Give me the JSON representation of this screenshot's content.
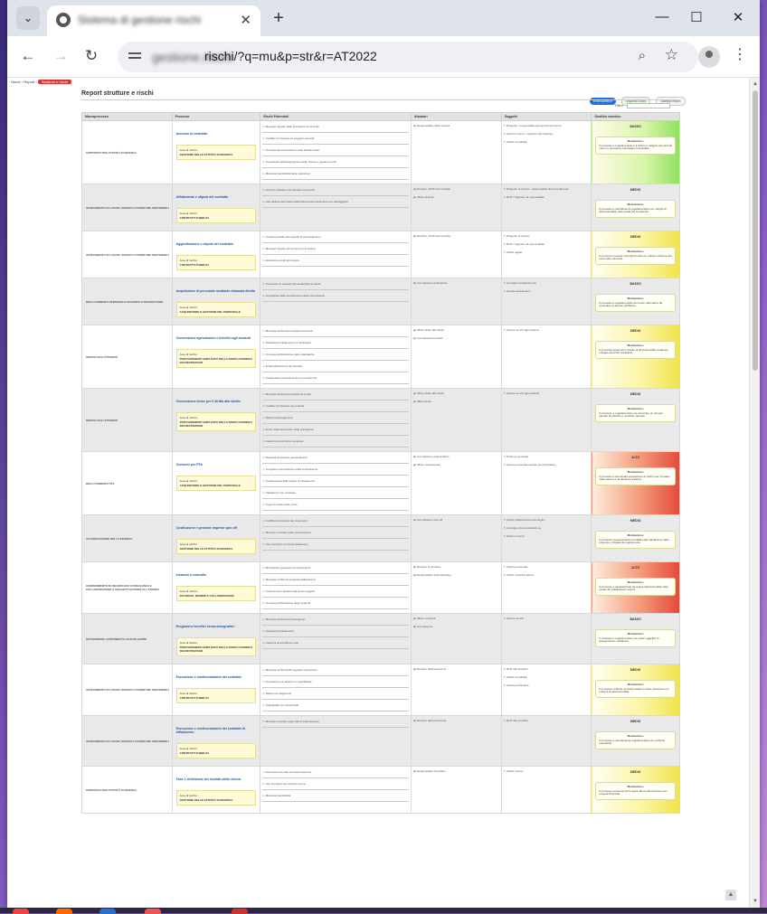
{
  "browser": {
    "tab_title": "Sistema di gestione rischi",
    "host_blurred": "gestione.rischi",
    "url": "rischi/?q=mu&p=str&r=AT2022"
  },
  "page": {
    "breadcrumb": [
      "Home",
      "Report",
      "Strutture e rischi"
    ],
    "title": "Report strutture e rischi",
    "actions": [
      "ESEGUIBILE",
      "Esporta Excel",
      "Stampa report"
    ],
    "filter_label": "Filtro",
    "filter_value": ""
  },
  "table": {
    "headers": [
      "Macroprocesso",
      "Processo",
      "Rischi Potenziali",
      "Attuatori",
      "Soggetti",
      "Giudizio sintetico"
    ],
    "rows": [
      {
        "macro": "SUPPORTO PER ATTIVITÀ DI RICERCA",
        "process": "Accesso al contratto",
        "area": "GESTIONE DELLE ATTIVITÀ DI RICERCA",
        "risks": [
          "Mancato rispetto delle procedure di controllo",
          "Conflitto di interessi tra soggetti coinvolti",
          "Omessa documentazione delle attività svolte",
          "Irregolarità nell'assegnazione delle risorse e gestione fondi",
          "Mancata tracciabilità delle operazioni"
        ],
        "actors": [
          "Responsabile ufficio ricerca"
        ],
        "subjects": [
          "Dirigente / responsabile del servizio di ricerca",
          "Settore ricerca - supporto alle strutture",
          "Ufficio contabilità"
        ],
        "level": "BASSO",
        "level_key": "g-basso",
        "motivation": "Il processo è regolamentato e il rischio è mitigato da controlli interni e procedure strutturate consolidate."
      },
      {
        "macro": "AFFIDAMENTO DI LAVORI, SERVIZI E FORNITURE SOSTENIBILI",
        "process": "Affidamento e stipula del contratto",
        "area": "CONTRATTI PUBBLICI",
        "risks": [
          "Accordo collusivo tra operatori economici",
          "Uso distorto del criterio dell'offerta economicamente più vantaggiosa"
        ],
        "actors": [
          "Direttore / RUP del contratto",
          "Ufficio acquisti"
        ],
        "subjects": [
          "Dirigente di settore - responsabile del procedimento",
          "RUP / Supporto al responsabile"
        ],
        "level": "MEDIO",
        "level_key": "g-medio",
        "motivation": "Il processo è parzialmente regolamentato con margini di discrezionalità nella scelta del contraente."
      },
      {
        "macro": "AFFIDAMENTO DI LAVORI, SERVIZI E FORNITURE SOSTENIBILI",
        "process": "Aggiudicazione e stipula del contratto",
        "area": "CONTRATTI PUBBLICI",
        "risks": [
          "Verifica parziale dei requisiti di partecipazione",
          "Mancato rispetto dei termini per la stipula",
          "Alterazione degli atti di gara"
        ],
        "actors": [
          "Direttore / RUP del contratto"
        ],
        "subjects": [
          "Dirigente di settore",
          "RUP / Supporto al responsabile",
          "Ufficio legale"
        ],
        "level": "MEDIO",
        "level_key": "g-medio",
        "motivation": "Il processo prevede controlli formali con ridotta rotazione del personale coinvolto."
      },
      {
        "macro": "RECLUTAMENTO PERSONALE DOCENTE E RICERCATORE",
        "process": "Acquisizione di personale mediante chiamata diretta",
        "area": "ACQUISIZIONE E GESTIONE DEL PERSONALE",
        "risks": [
          "Previsione di requisiti personalizzati nei bandi",
          "Irregolarità nella composizione delle commissioni"
        ],
        "actors": [
          "Commissione giudicatrice"
        ],
        "subjects": [
          "Consiglio di dipartimento",
          "Senato accademico"
        ],
        "level": "BASSO",
        "level_key": "g-basso",
        "motivation": "Il processo è regolamentato da norme nazionali e da procedure di ateneo pubbliche."
      },
      {
        "macro": "SERVIZI AGLI STUDENTI",
        "process": "Concessione agevolazioni e benefici agli studenti",
        "area": "PROVVEDIMENTI AMPLIATIVI DELLA SFERA GIURIDICA DEI DESTINATARI",
        "risks": [
          "Mancata verifica dei requisiti economici",
          "Disparità di trattamento tra richiedenti",
          "Omessa pubblicazione delle graduatorie",
          "Errata attribuzione dei benefici",
          "Inadeguata motivazione dei provvedimenti"
        ],
        "actors": [
          "Ufficio diritto allo studio",
          "Commissione benefici"
        ],
        "subjects": [
          "Settore servizi agli studenti"
        ],
        "level": "MEDIO",
        "level_key": "g-medio",
        "motivation": "Il processo presenta un livello di discrezionalità moderato, mitigato da criteri predefiniti."
      },
      {
        "macro": "SERVIZI AGLI STUDENTI",
        "process": "Concessione borse per il diritto allo studio",
        "area": "PROVVEDIMENTI AMPLIATIVI DELLA SFERA GIURIDICA DEI DESTINATARI",
        "risks": [
          "Mancata verifica dei requisiti di merito",
          "Conflitto di interessi nei controlli",
          "Ritardi nell'erogazione",
          "Errori nella formazione delle graduatorie",
          "Carenza di controlli a campione"
        ],
        "actors": [
          "Ufficio diritto allo studio",
          "Ufficio borse"
        ],
        "subjects": [
          "Settore servizi agli studenti"
        ],
        "level": "MEDIO",
        "level_key": "g-medio",
        "motivation": "Il processo è regolamentato ma coinvolge un numero elevato di pratiche e verifiche manuali."
      },
      {
        "macro": "RECLUTAMENTO PTA",
        "process": "Concorsi per PTA",
        "area": "ACQUISIZIONE E GESTIONE DEL PERSONALE",
        "risks": [
          "Requisiti di accesso personalizzati",
          "Irregolare composizione della commissione",
          "Inosservanza delle regole di trasparenza",
          "Valutazioni non motivate",
          "Fuga di notizie sulle prove"
        ],
        "actors": [
          "Commissione esaminatrice",
          "Ufficio reclutamento"
        ],
        "subjects": [
          "Direttore generale",
          "Settore personale tecnico amministrativo"
        ],
        "level": "ALTO",
        "level_key": "g-alto",
        "motivation": "Il processo è ad elevata esposizione al rischio per l'impatto sulle carriere e la rilevanza esterna."
      },
      {
        "macro": "VALORIZZAZIONE DELLA RICERCA",
        "process": "Costituzione e gestione imprese spin off",
        "area": "GESTIONE DELLE ATTIVITÀ DI RICERCA",
        "risks": [
          "Conflitto di interessi dei proponenti",
          "Mancato controllo sulle partecipazioni",
          "Uso improprio di risorse dell'ateneo"
        ],
        "actors": [
          "Commissione spin off"
        ],
        "subjects": [
          "Ufficio trasferimento tecnologico",
          "Consiglio di amministrazione",
          "Settore ricerca"
        ],
        "level": "MEDIO",
        "level_key": "g-medio",
        "motivation": "Il processo presenta discrezionalità nella valutazione delle proposte, mitigata da regolamento."
      },
      {
        "macro": "CONFERIMENTO DI INCARICHI DI CONSULENZA E COLLABORAZIONE A SOGGETTI ESTERNI ALL'ATENEO",
        "process": "Incarichi a contratto",
        "area": "INCARICHI, NOMINE E COLLABORAZIONI",
        "risks": [
          "Motivazione generica sui presupposti",
          "Mancata verifica di professionalità interne",
          "Conferimento ripetuto agli stessi soggetti",
          "Omessa pubblicazione degli incarichi"
        ],
        "actors": [
          "Direttore di struttura",
          "Responsabile amministrativo"
        ],
        "subjects": [
          "Settore personale",
          "Ufficio incarichi esterni"
        ],
        "level": "ALTO",
        "level_key": "g-alto",
        "motivation": "Il processo è caratterizzato da ampia discrezionalità nella scelta dei collaboratori esterni."
      },
      {
        "macro": "SOVVENZIONI, CONTRIBUTI E AGEVOLAZIONI",
        "process": "Erogazione benefici senza assegnatari",
        "area": "PROVVEDIMENTI AMPLIATIVI DELLA SFERA GIURIDICA DEI DESTINATARI",
        "risks": [
          "Mancata verifica dei presupposti",
          "Disparità di trattamento",
          "Carenza di controlli ex post"
        ],
        "actors": [
          "Ufficio contributi",
          "Commissione"
        ],
        "subjects": [
          "Settore servizi"
        ],
        "level": "BASSO",
        "level_key": "g-basso",
        "motivation": "Il processo è regolamentato con criteri oggettivi di assegnazione pubblicati."
      },
      {
        "macro": "AFFIDAMENTO DI LAVORI, SERVIZI E FORNITURE SOSTENIBILI",
        "process": "Esecuzione e rendicontazione del contratto",
        "area": "CONTRATTI PUBBLICI",
        "risks": [
          "Mancata verifica della regolare esecuzione",
          "Ammissione di varianti non giustificate",
          "Ritardi nei pagamenti",
          "Subappalto non autorizzato"
        ],
        "actors": [
          "Direttore dell'esecuzione"
        ],
        "subjects": [
          "RUP del contratto",
          "Ufficio contabilità",
          "Settore patrimonio"
        ],
        "level": "MEDIO",
        "level_key": "g-medio",
        "motivation": "Il processo richiede controlli costanti in fase esecutiva con margini di discrezionalità."
      },
      {
        "macro": "AFFIDAMENTO DI LAVORI, SERVIZI E FORNITURE SOSTENIBILI",
        "process": "Esecuzione e rendicontazione del contratto di affidamento",
        "area": "CONTRATTI PUBBLICI",
        "risks": [
          "Mancato controllo sugli stati di avanzamento"
        ],
        "actors": [
          "Direttore dell'esecuzione"
        ],
        "subjects": [
          "RUP del contratto"
        ],
        "level": "MEDIO",
        "level_key": "g-medio",
        "motivation": "Il processo è parzialmente regolamentato con verifiche periodiche."
      },
      {
        "macro": "SUPPORTO PER ATTIVITÀ DI RICERCA",
        "process": "Fase 1 definizione dei risultati della ricerca",
        "area": "GESTIONE DELLE ATTIVITÀ DI RICERCA",
        "risks": [
          "Alterazione dei dati di rendicontazione",
          "Uso improprio dei fondi di ricerca",
          "Mancata tracciabilità"
        ],
        "actors": [
          "Responsabile scientifico"
        ],
        "subjects": [
          "Ufficio ricerca"
        ],
        "level": "MEDIO",
        "level_key": "g-medio",
        "motivation": "Il processo presenta rischi legati alla rendicontazione dei progetti finanziati."
      }
    ],
    "area_prefix": "Area di rischio:",
    "motivation_label": "Motivazione:"
  }
}
